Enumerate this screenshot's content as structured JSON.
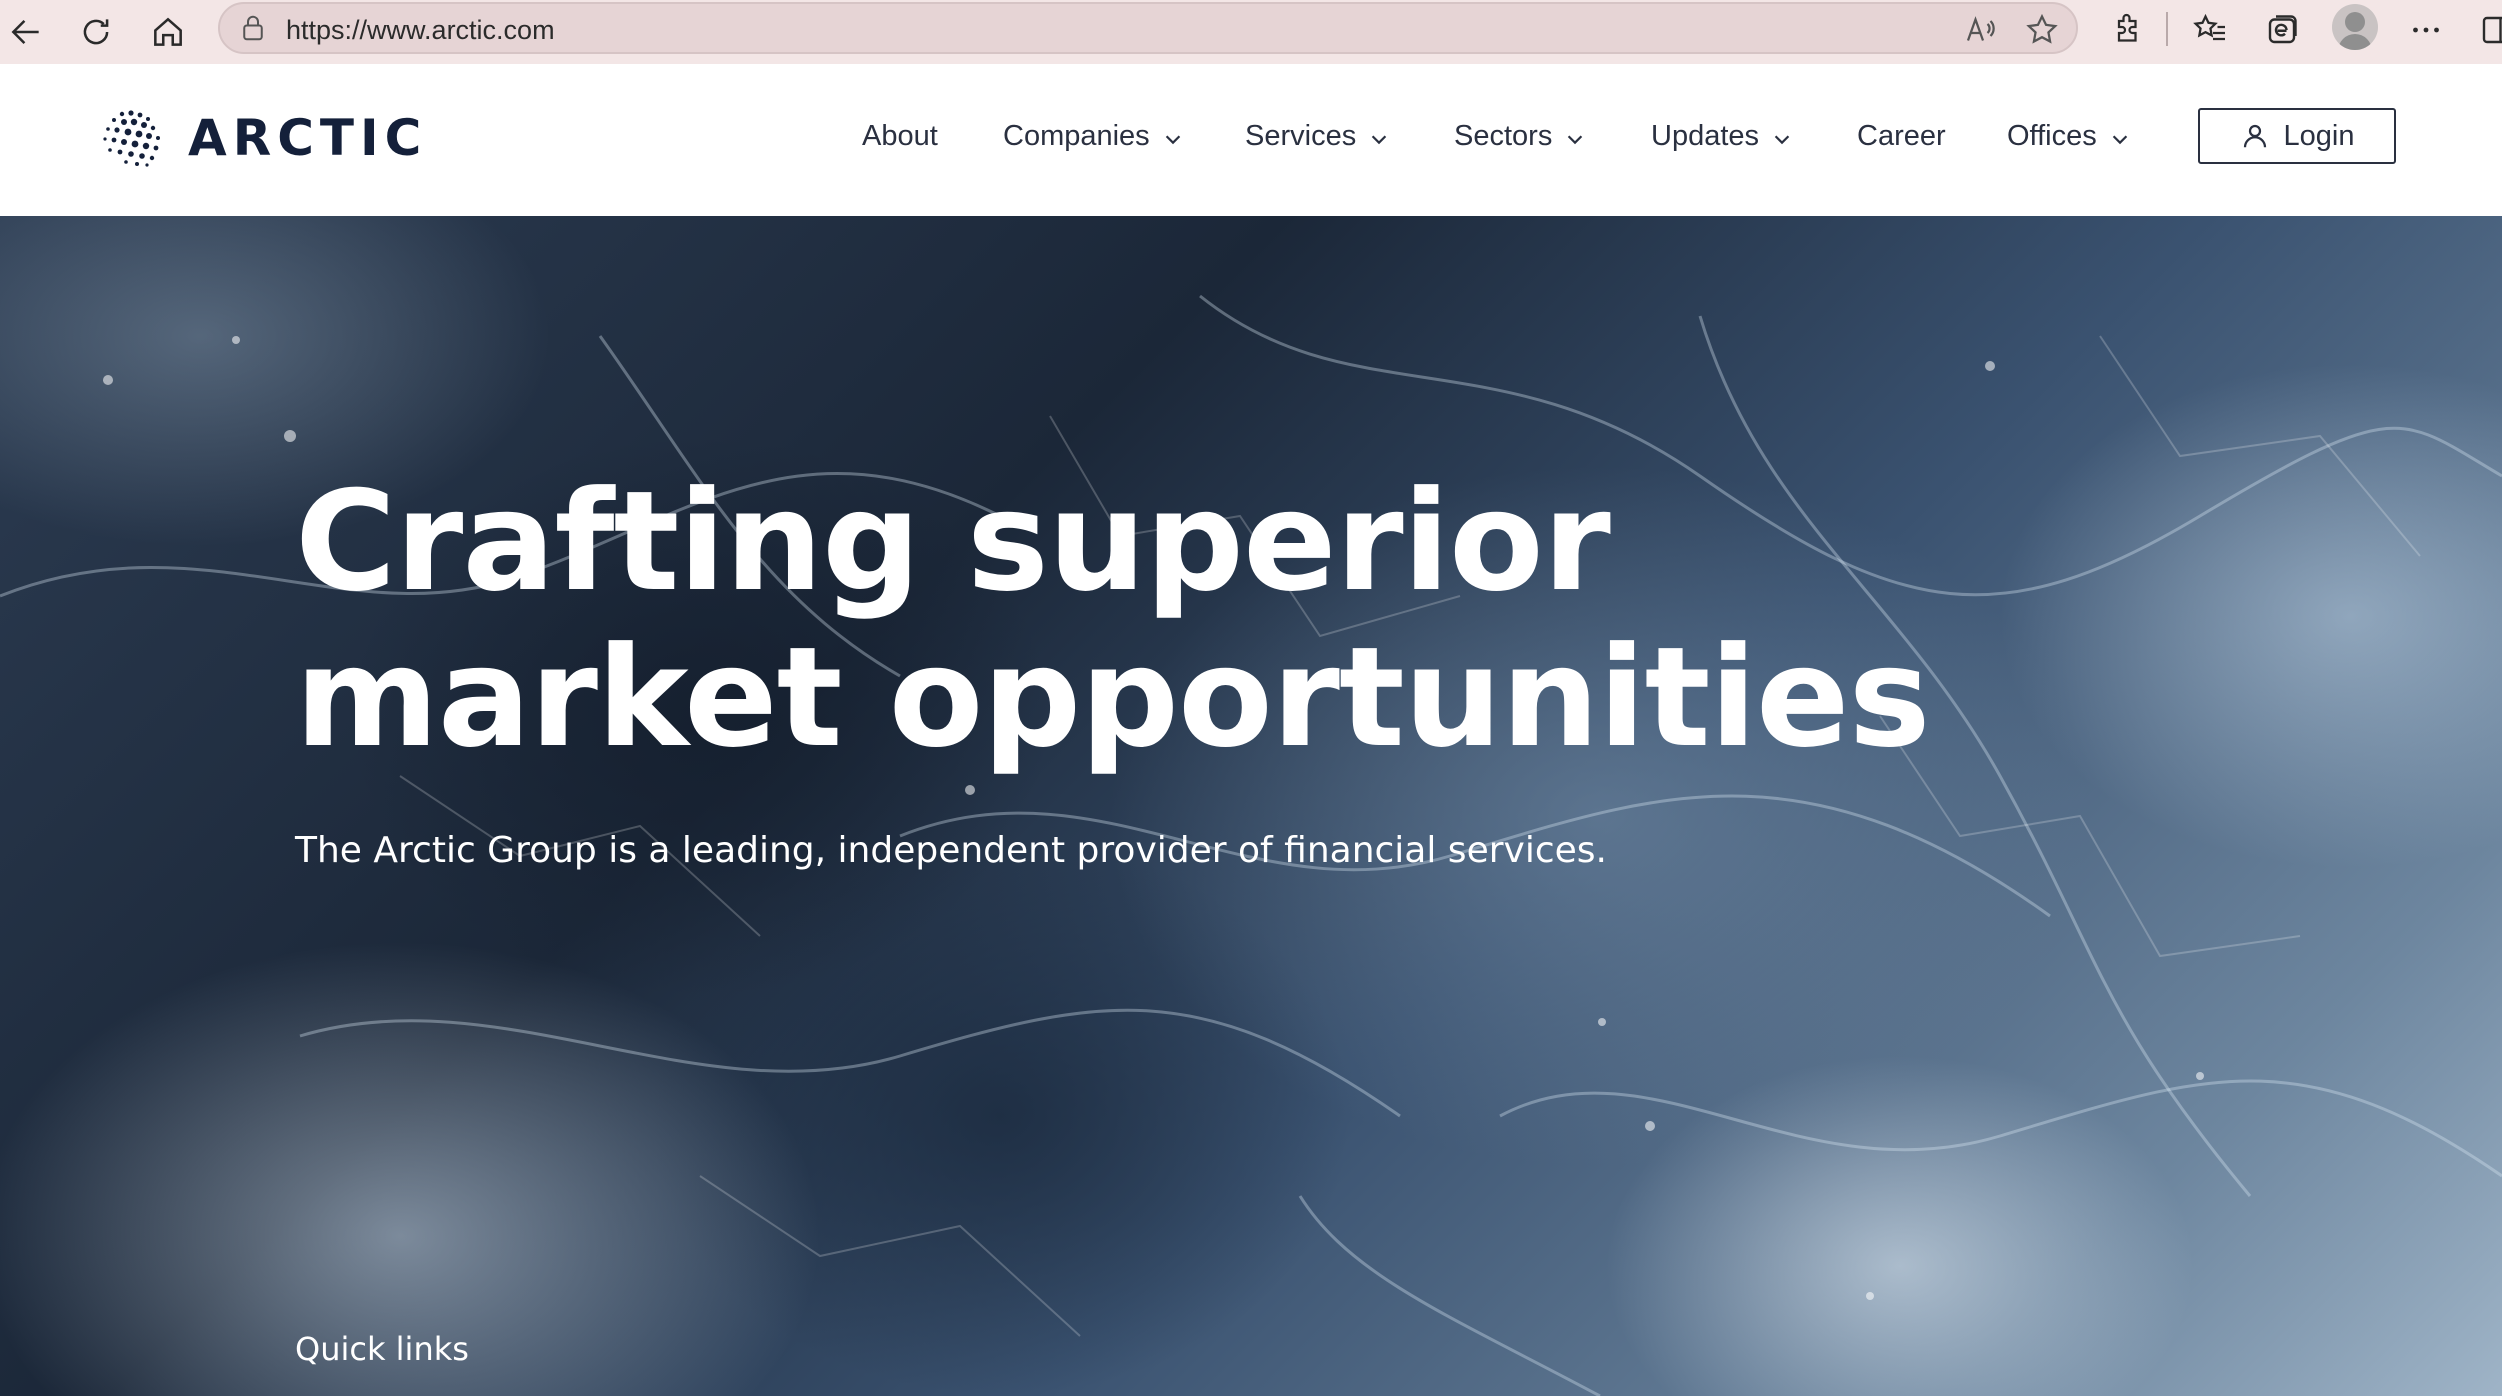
{
  "browser": {
    "url": "https://www.arctic.com",
    "icons": [
      "back-arrow-icon",
      "refresh-icon",
      "home-icon",
      "lock-icon",
      "read-aloud-icon",
      "favorite-star-icon",
      "extensions-icon",
      "favorites-list-icon",
      "collections-icon",
      "profile-avatar",
      "more-menu-icon"
    ]
  },
  "site": {
    "logo_text": "ARCTIC",
    "nav": [
      {
        "label": "About",
        "dropdown": false
      },
      {
        "label": "Companies",
        "dropdown": true
      },
      {
        "label": "Services",
        "dropdown": true
      },
      {
        "label": "Sectors",
        "dropdown": true
      },
      {
        "label": "Updates",
        "dropdown": true
      },
      {
        "label": "Career",
        "dropdown": false
      },
      {
        "label": "Offices",
        "dropdown": true
      }
    ],
    "login_label": "Login",
    "colors": {
      "brand": "#14203a",
      "nav_text": "#2a3040",
      "hero_text": "#ffffff"
    }
  },
  "hero": {
    "title": "Crafting superior market opportunities",
    "subtitle": "The Arctic Group is a leading, independent provider of financial services.",
    "quick_links_label": "Quick links"
  }
}
